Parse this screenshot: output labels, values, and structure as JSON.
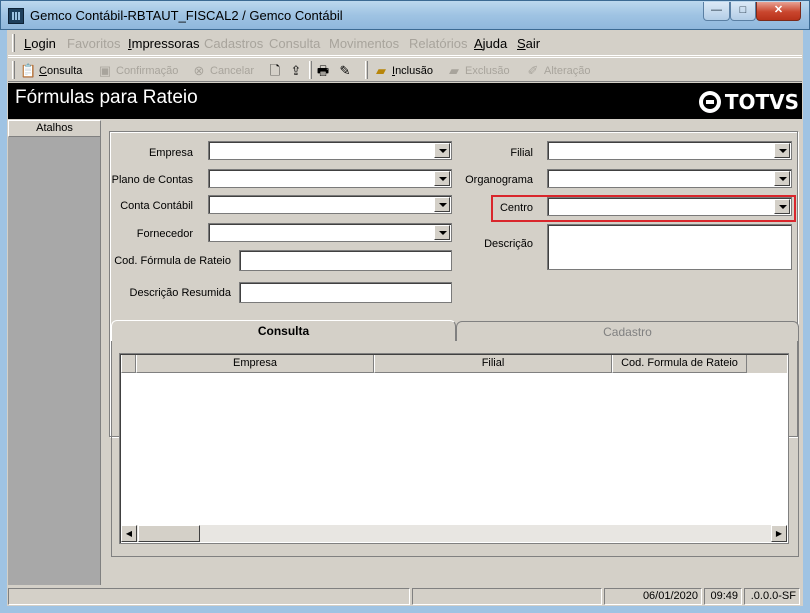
{
  "window": {
    "title": "Gemco Contábil-RBTAUT_FISCAL2 / Gemco Contábil",
    "min_glyph": "—",
    "max_glyph": "□",
    "close_glyph": "✕"
  },
  "menu": [
    {
      "label": "Login",
      "enabled": true
    },
    {
      "label": "Favoritos",
      "enabled": false
    },
    {
      "label": "Impressoras",
      "enabled": true
    },
    {
      "label": "Cadastros",
      "enabled": false
    },
    {
      "label": "Consulta",
      "enabled": false
    },
    {
      "label": "Movimentos",
      "enabled": false
    },
    {
      "label": "Relatórios",
      "enabled": false
    },
    {
      "label": "Ajuda",
      "enabled": true
    },
    {
      "label": "Sair",
      "enabled": true
    }
  ],
  "toolbar": {
    "consulta": {
      "label": "Consulta",
      "icon": "consulta-icon"
    },
    "confirmacao": {
      "label": "Confirmação",
      "icon": "save-icon"
    },
    "cancelar": {
      "label": "Cancelar",
      "icon": "cancel-icon"
    },
    "new_icon": "new-document-icon",
    "export_icon": "export-icon",
    "print_icon": "print-icon",
    "preview_icon": "print-preview-icon",
    "inclusao": {
      "label": "Inclusão",
      "icon": "folder-add-icon"
    },
    "exclusao": {
      "label": "Exclusão",
      "icon": "delete-icon"
    },
    "alteracao": {
      "label": "Alteração",
      "icon": "edit-icon"
    }
  },
  "header": {
    "title": "Fórmulas para Rateio",
    "logo_text": "TOTVS"
  },
  "sidebar": {
    "tab_label": "Atalhos"
  },
  "form": {
    "empresa_label": "Empresa",
    "plano_label": "Plano de Contas",
    "conta_label": "Conta Contábil",
    "fornecedor_label": "Fornecedor",
    "cod_formula_label": "Cod. Fórmula de Rateio",
    "descricao_resumida_label": "Descrição Resumida",
    "filial_label": "Filial",
    "organograma_label": "Organograma",
    "centro_label": "Centro",
    "descricao_label": "Descrição",
    "empresa_value": "",
    "plano_value": "",
    "conta_value": "",
    "fornecedor_value": "",
    "cod_formula_value": "",
    "descricao_resumida_value": "",
    "filial_value": "",
    "organograma_value": "",
    "centro_value": "",
    "descricao_value": "",
    "highlight_color": "#d9262c"
  },
  "tabs": [
    {
      "label": "Consulta",
      "active": true
    },
    {
      "label": "Cadastro",
      "active": false
    }
  ],
  "grid": {
    "columns": [
      "Empresa",
      "Filial",
      "Cod. Formula de Rateio"
    ],
    "rows": []
  },
  "status": {
    "date": "06/01/2020",
    "time": "09:49",
    "version": ".0.0.0-SF"
  }
}
